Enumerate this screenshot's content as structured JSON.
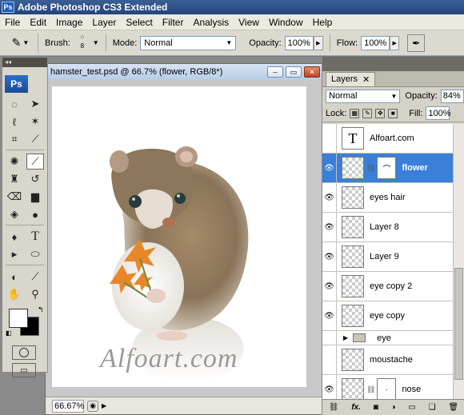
{
  "app": {
    "title": "Adobe Photoshop CS3 Extended",
    "badge": "Ps"
  },
  "menu": [
    "File",
    "Edit",
    "Image",
    "Layer",
    "Select",
    "Filter",
    "Analysis",
    "View",
    "Window",
    "Help"
  ],
  "options": {
    "brush_label": "Brush:",
    "brush_size": "8",
    "mode_label": "Mode:",
    "mode_value": "Normal",
    "opacity_label": "Opacity:",
    "opacity_value": "100%",
    "flow_label": "Flow:",
    "flow_value": "100%"
  },
  "document": {
    "title": "hamster_test.psd @ 66.7% (flower, RGB/8*)",
    "zoom": "66.67%",
    "watermark": "Alfoart.com"
  },
  "toolbox": {
    "logo": "Ps"
  },
  "layers_panel": {
    "tab_label": "Layers",
    "blend_mode": "Normal",
    "opacity_label": "Opacity:",
    "opacity_value": "84%",
    "lock_label": "Lock:",
    "fill_label": "Fill:",
    "fill_value": "100%",
    "layers": [
      {
        "name": "Alfoart.com",
        "kind": "text",
        "visible": false,
        "selected": false
      },
      {
        "name": "flower",
        "kind": "masked",
        "visible": true,
        "selected": true
      },
      {
        "name": "eyes hair",
        "kind": "pixel",
        "visible": true,
        "selected": false
      },
      {
        "name": "Layer 8",
        "kind": "pixel",
        "visible": true,
        "selected": false
      },
      {
        "name": "Layer 9",
        "kind": "pixel",
        "visible": true,
        "selected": false
      },
      {
        "name": "eye copy 2",
        "kind": "pixel",
        "visible": true,
        "selected": false
      },
      {
        "name": "eye copy",
        "kind": "pixel",
        "visible": true,
        "selected": false
      },
      {
        "name": "eye",
        "kind": "group",
        "visible": false,
        "selected": false
      },
      {
        "name": "moustache",
        "kind": "pixel",
        "visible": false,
        "selected": false
      },
      {
        "name": "nose",
        "kind": "masked",
        "visible": true,
        "selected": false
      }
    ],
    "footer_icons": [
      "link-icon",
      "fx-icon",
      "mask-icon",
      "adjustment-icon",
      "group-icon",
      "new-layer-icon",
      "trash-icon"
    ]
  },
  "colors": {
    "selected_layer": "#3a80d8",
    "title_bar": "#24457c"
  }
}
